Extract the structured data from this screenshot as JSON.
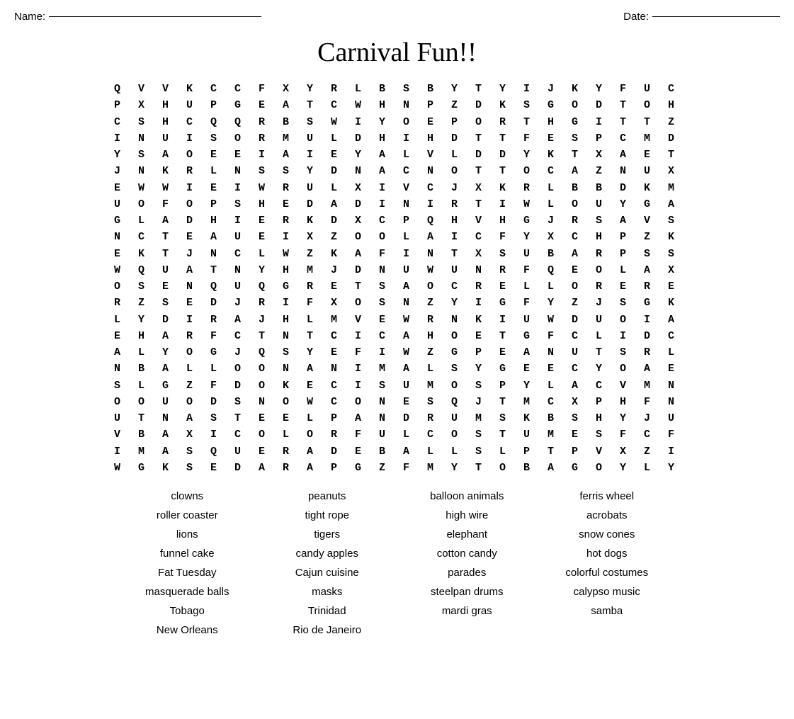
{
  "header": {
    "name_label": "Name:",
    "date_label": "Date:"
  },
  "title": "Carnival Fun!!",
  "grid": {
    "rows": [
      "Q V V K C C F X Y R L B S B Y T Y I J K Y F U C",
      "P X H U P G E A T C W H N P Z D K S G O D T O H",
      "C S H C Q Q R B S W I Y O E P O R T H G I T T Z",
      "I N U I S O R M U L D H I H D T T F E S P C M D",
      "Y S A O E E I A I E Y A L V L D D Y K T X A E T",
      "J N K R L N S S Y D N A C N O T T O C A Z N U X",
      "E W W I E I W R U L X I V C J X K R L B B D K M",
      "U O F O P S H E D A D I N I R T I W L O U Y G A",
      "G L A D H I E R K D X C P Q H V H G J R S A V S",
      "N C T E A U E I X Z O O L A I C F Y X C H P Z K",
      "E K T J N C L W Z K A F I N T X S U B A R P S S",
      "W Q U A T N Y H M J D N U W U N R F Q E O L A X",
      "O S E N Q U Q G R E T S A O C R E L L O R E R E",
      "R Z S E D J R I F X O S N Z Y I G F Y Z J S G K",
      "L Y D I R A J H L M V E W R N K I U W D U O I A",
      "E H A R F C T N T C I C A H O E T G F C L I D C",
      "A L Y O G J Q S Y E F I W Z G P E A N U T S R L",
      "N B A L L O O N A N I M A L S Y G E E C Y O A E",
      "S L G Z F D O K E C I S U M O S P Y L A C V M N",
      "O O U O D S N O W C O N E S Q J T M C X P H F N",
      "U T N A S T E E L P A N D R U M S K B S H Y J U",
      "V B A X I C O L O R F U L C O S T U M E S F C F",
      "I M A S Q U E R A D E B A L L S L P T P V X Z I",
      "W G K S E D A R A P G Z F M Y T O B A G O Y L Y"
    ]
  },
  "words": [
    {
      "col": 0,
      "text": "clowns"
    },
    {
      "col": 1,
      "text": "peanuts"
    },
    {
      "col": 2,
      "text": "balloon animals"
    },
    {
      "col": 3,
      "text": "ferris wheel"
    },
    {
      "col": 0,
      "text": "roller coaster"
    },
    {
      "col": 1,
      "text": "tight rope"
    },
    {
      "col": 2,
      "text": "high wire"
    },
    {
      "col": 3,
      "text": "acrobats"
    },
    {
      "col": 0,
      "text": "lions"
    },
    {
      "col": 1,
      "text": "tigers"
    },
    {
      "col": 2,
      "text": "elephant"
    },
    {
      "col": 3,
      "text": "snow cones"
    },
    {
      "col": 0,
      "text": "funnel cake"
    },
    {
      "col": 1,
      "text": "candy apples"
    },
    {
      "col": 2,
      "text": "cotton candy"
    },
    {
      "col": 3,
      "text": "hot dogs"
    },
    {
      "col": 0,
      "text": "Fat Tuesday"
    },
    {
      "col": 1,
      "text": "Cajun cuisine"
    },
    {
      "col": 2,
      "text": "parades"
    },
    {
      "col": 3,
      "text": "colorful costumes"
    },
    {
      "col": 0,
      "text": "masquerade balls"
    },
    {
      "col": 1,
      "text": "masks"
    },
    {
      "col": 2,
      "text": "steelpan drums"
    },
    {
      "col": 3,
      "text": "calypso music"
    },
    {
      "col": 0,
      "text": "Tobago"
    },
    {
      "col": 1,
      "text": "Trinidad"
    },
    {
      "col": 2,
      "text": "mardi gras"
    },
    {
      "col": 3,
      "text": "samba"
    },
    {
      "col": 0,
      "text": "New Orleans"
    },
    {
      "col": 1,
      "text": "Rio de Janeiro"
    },
    {
      "col": 2,
      "text": ""
    },
    {
      "col": 3,
      "text": ""
    }
  ]
}
